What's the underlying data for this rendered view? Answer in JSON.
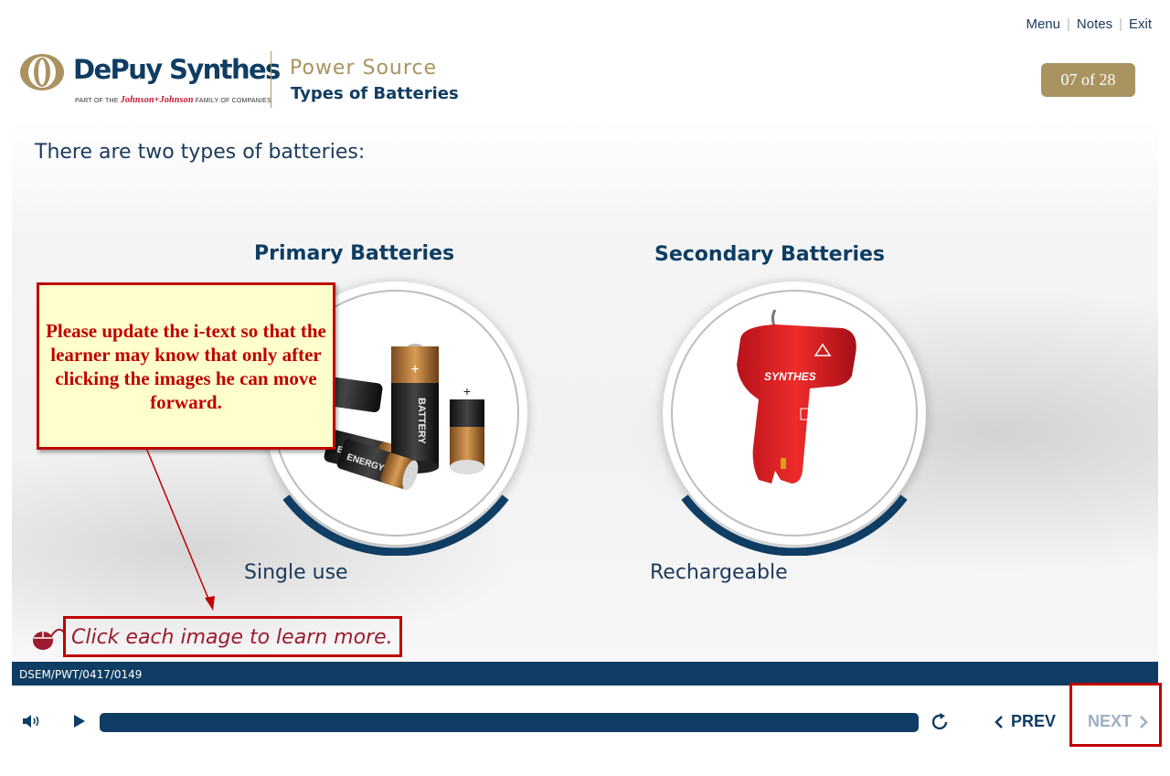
{
  "top_nav": {
    "menu": "Menu",
    "notes": "Notes",
    "exit": "Exit",
    "separator": "|"
  },
  "brand": {
    "name": "DePuy Synthes",
    "tagline_prefix": "PART OF THE",
    "tagline_jj": "Johnson+Johnson",
    "tagline_suffix": "FAMILY OF COMPANIES",
    "colors": {
      "navy": "#0f3d63",
      "gold": "#a99360",
      "red": "#c00000"
    }
  },
  "course": {
    "title": "Power Source",
    "subtitle": "Types of Batteries"
  },
  "page_counter": "07 of 28",
  "content": {
    "intro": "There are two types of batteries:",
    "cards": [
      {
        "title": "Primary Batteries",
        "caption": "Single use",
        "image": "batteries-image"
      },
      {
        "title": "Secondary Batteries",
        "caption": "Rechargeable",
        "image": "synthes-battery-pack-image"
      }
    ],
    "hint": "Click each image to learn more.",
    "product_labels": {
      "battery": "BATTERY",
      "energy": "ENERGY",
      "synthes": "SYNTHES"
    }
  },
  "review_note": "Please update the i-text so that the learner may know that only after clicking the images he can move forward.",
  "footer": {
    "code": "DSEM/PWT/0417/0149"
  },
  "player": {
    "prev_label": "PREV",
    "next_label": "NEXT",
    "icons": [
      "volume-icon",
      "play-icon",
      "replay-icon",
      "chevron-left-icon",
      "chevron-right-icon"
    ]
  }
}
